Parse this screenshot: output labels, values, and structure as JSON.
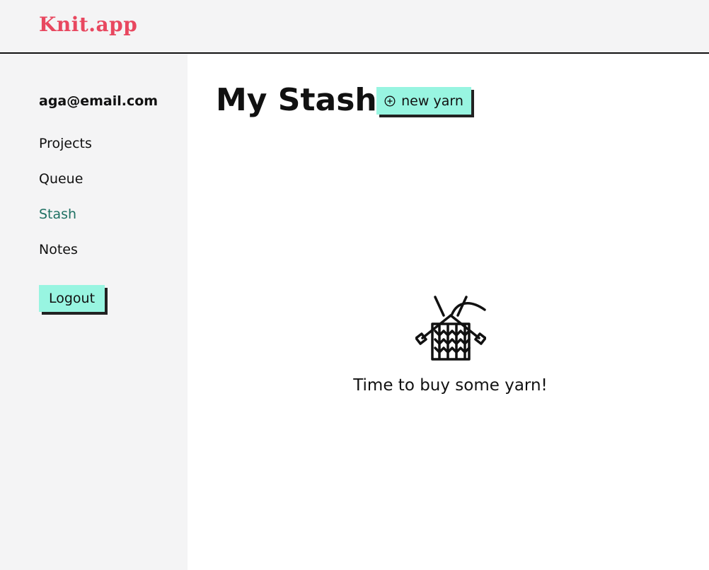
{
  "header": {
    "logo_text": "Knit.app",
    "brand_color": "#e8475f"
  },
  "sidebar": {
    "user_email": "aga@email.com",
    "nav": [
      {
        "label": "Projects",
        "active": false
      },
      {
        "label": "Queue",
        "active": false
      },
      {
        "label": "Stash",
        "active": true
      },
      {
        "label": "Notes",
        "active": false
      }
    ],
    "logout_label": "Logout",
    "active_color": "#1f7163",
    "background": "#f4f4f5"
  },
  "main": {
    "title": "My Stash",
    "new_button": {
      "label": "new yarn",
      "icon": "plus-circle-icon"
    },
    "empty_state": {
      "icon": "knitting-icon",
      "message": "Time to buy some yarn!"
    }
  },
  "colors": {
    "button_bg": "#98f5e1",
    "button_shadow": "#222222"
  }
}
